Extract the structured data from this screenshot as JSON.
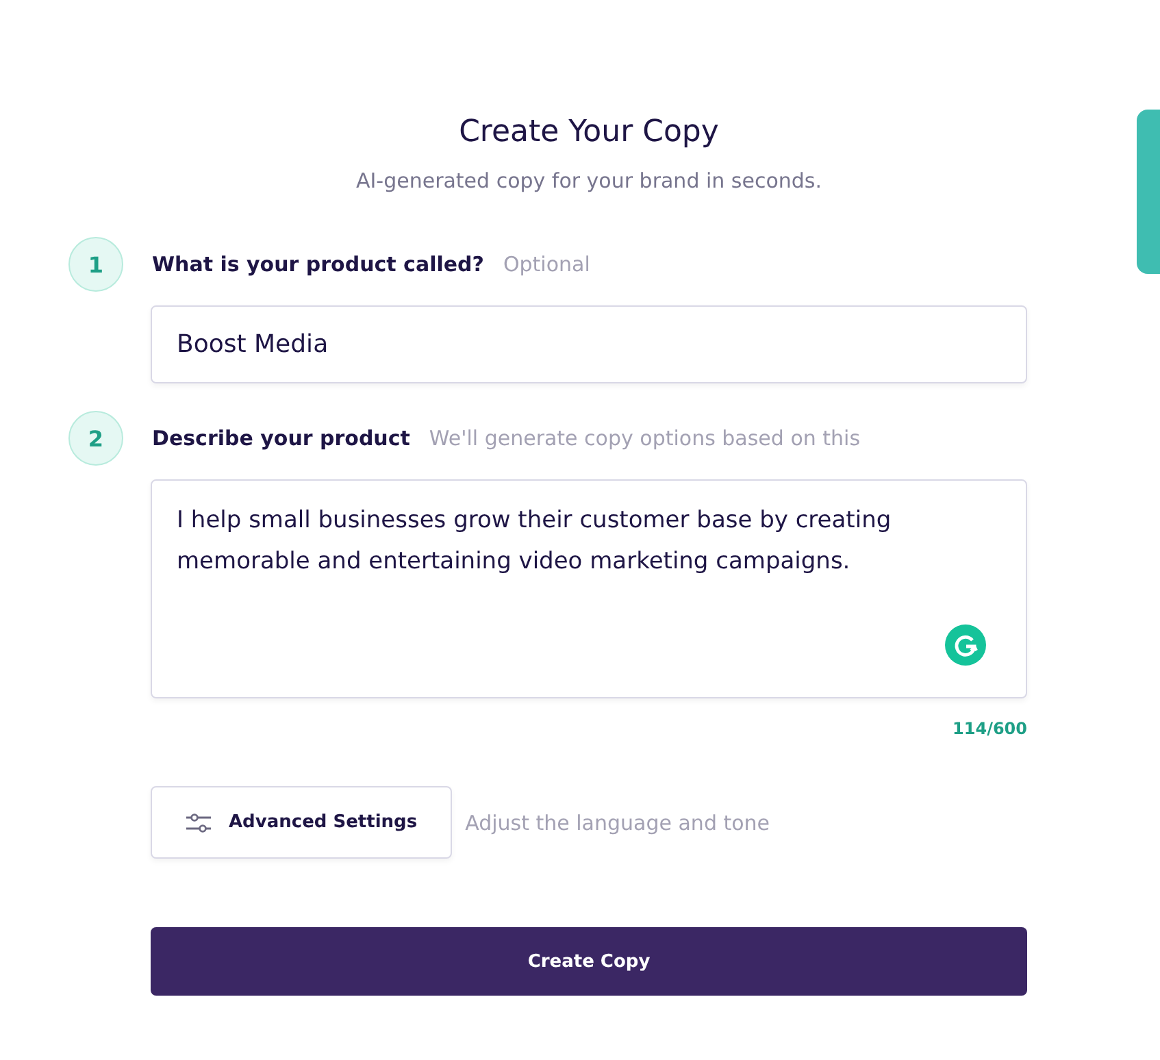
{
  "header": {
    "title": "Create Your Copy",
    "subtitle": "AI-generated copy for your brand in seconds."
  },
  "steps": [
    {
      "number": "1",
      "label": "What is your product called?",
      "hint": "Optional",
      "kind": "input",
      "value": "Boost Media"
    },
    {
      "number": "2",
      "label": "Describe your product",
      "hint": "We'll generate copy options based on this",
      "kind": "textarea",
      "value": "I help small businesses grow their customer base by creating memorable and entertaining video marketing campaigns.",
      "counter": "114/600"
    }
  ],
  "advanced": {
    "button": "Advanced Settings",
    "hint": "Adjust the language and tone"
  },
  "submit": "Create Copy"
}
